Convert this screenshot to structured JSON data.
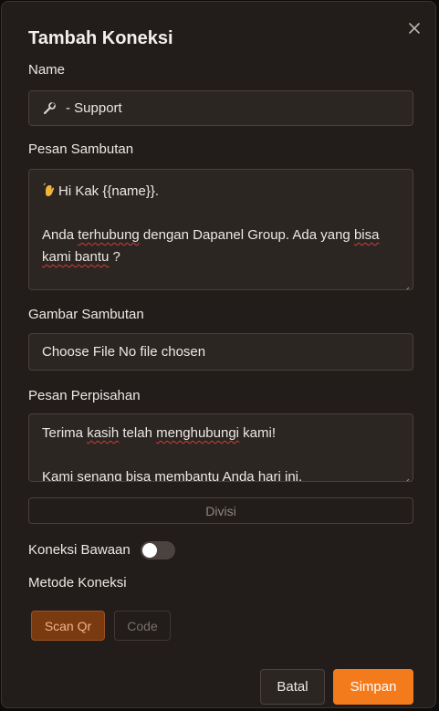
{
  "dialog": {
    "title": "Tambah Koneksi"
  },
  "form": {
    "name": {
      "label": "Name",
      "value": "- Support",
      "icon": "wrench-icon"
    },
    "welcome_message": {
      "label": "Pesan Sambutan",
      "icon": "waving-hand-icon",
      "line1": "Hi Kak {{name}}.",
      "line2": "",
      "line3_prefix": "Anda ",
      "line3_misspelled": "terhubung",
      "line3_middle": " dengan Dapanel Group. Ada yang ",
      "line3_misspelled2": "bisa",
      "line4_misspelled": "kami bantu",
      "line4_suffix": " ?"
    },
    "welcome_image": {
      "label": "Gambar Sambutan",
      "button_label": "Choose File",
      "status": "No file chosen"
    },
    "farewell_message": {
      "label": "Pesan Perpisahan",
      "line1_prefix": "Terima ",
      "line1_misspelled": "kasih",
      "line1_middle": " telah ",
      "line1_misspelled2": "menghubungi",
      "line1_suffix": " kami!",
      "line2": "",
      "line3": "Kami senang bisa membantu Anda hari ini."
    },
    "division": {
      "label": "Divisi"
    },
    "default_connection": {
      "label": "Koneksi Bawaan",
      "enabled": false
    },
    "connection_method": {
      "label": "Metode Koneksi",
      "options": [
        "Scan Qr",
        "Code"
      ],
      "selected": "Scan Qr"
    }
  },
  "footer": {
    "cancel_label": "Batal",
    "save_label": "Simpan"
  },
  "colors": {
    "accent": "#f47b1c",
    "selected_method_bg": "#7a3a10",
    "dialog_bg": "#221d1a"
  }
}
